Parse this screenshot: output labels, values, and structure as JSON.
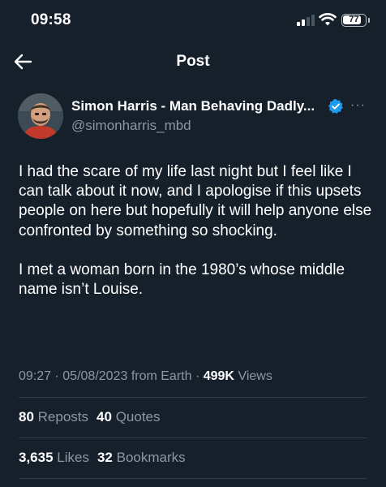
{
  "status_bar": {
    "time": "09:58",
    "battery": "77"
  },
  "header": {
    "title": "Post",
    "back_icon": "arrow-left-icon"
  },
  "author": {
    "name": "Simon Harris - Man Behaving Dadly...",
    "handle": "@simonharris_mbd",
    "verified": true,
    "verified_color": "#1d9bf0"
  },
  "post": {
    "paragraphs": [
      "I had the scare of my life last night but I feel like I can talk about it now, and I apologise if this upsets people on here but hopefully it will help anyone else confronted by something so shocking.",
      "I met a woman born in the 1980’s whose middle name isn’t Louise."
    ]
  },
  "meta": {
    "time": "09:27",
    "date": "05/08/2023",
    "source": "from Earth",
    "views": "499K",
    "views_label": "Views"
  },
  "stats": {
    "reposts": "80",
    "reposts_label": "Reposts",
    "quotes": "40",
    "quotes_label": "Quotes",
    "likes": "3,635",
    "likes_label": "Likes",
    "bookmarks": "32",
    "bookmarks_label": "Bookmarks"
  },
  "colors": {
    "background": "#15202b",
    "secondary_text": "#8b98a5",
    "divider": "#2f3b47"
  }
}
